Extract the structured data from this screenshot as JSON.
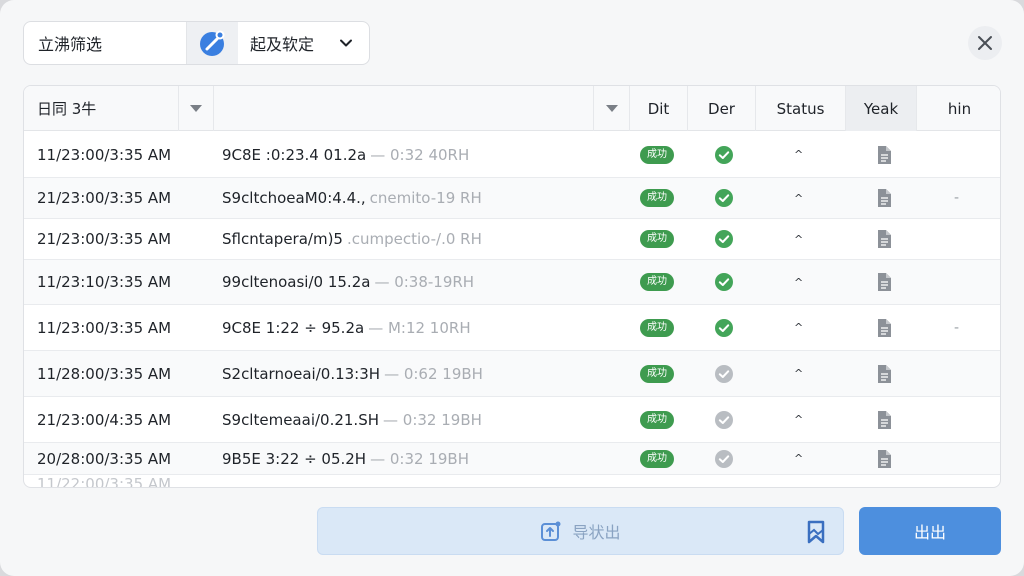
{
  "toolbar": {
    "filter_value": "立沸筛选",
    "filter_placeholder": "",
    "select_value": "起及软定"
  },
  "table": {
    "columns": [
      {
        "label": "日同 3牛"
      },
      {
        "label": ""
      },
      {
        "label": "Dit"
      },
      {
        "label": "Der"
      },
      {
        "label": "Status"
      },
      {
        "label": "Yeak"
      },
      {
        "label": "hin"
      }
    ],
    "rows": [
      {
        "date": "11/23:00/3:35 AM",
        "desc": "9C8E :0:23.4 01.2a",
        "desc_fade": "— 0:32 40RH",
        "badge": "成功",
        "check": "green",
        "caret": "^",
        "dash": ""
      },
      {
        "date": "21/23:00/3:35 AM",
        "desc": "S9cltchoeaM0:4.4.,",
        "desc_fade": "cnemito-19 RH",
        "badge": "成功",
        "check": "green",
        "caret": "^",
        "dash": "-"
      },
      {
        "date": "21/23:00/3:35 AM",
        "desc": "Sflcntapera/m)5",
        "desc_fade": ".cumpectio-/.0 RH",
        "badge": "成功",
        "check": "green",
        "caret": "^",
        "dash": ""
      },
      {
        "date": "11/23:10/3:35 AM",
        "desc": "99cltenoasi/0 15.2a",
        "desc_fade": "— 0:38-19RH",
        "badge": "成功",
        "check": "green",
        "caret": "^",
        "dash": ""
      },
      {
        "date": "11/23:00/3:35 AM",
        "desc": "9C8E 1:22 ÷ 95.2a",
        "desc_fade": "— M:12 10RH",
        "badge": "成功",
        "check": "green",
        "caret": "^",
        "dash": "-"
      },
      {
        "date": "11/28:00/3:35 AM",
        "desc": "S2cltarnoeai/0.13:3H",
        "desc_fade": "— 0:62 19BH",
        "badge": "成功",
        "check": "grey",
        "caret": "^",
        "dash": ""
      },
      {
        "date": "21/23:00/4:35 AM",
        "desc": "S9cltemeaai/0.21.SH",
        "desc_fade": "— 0:32 19BH",
        "badge": "成功",
        "check": "grey",
        "caret": "^",
        "dash": ""
      },
      {
        "date": "20/28:00/3:35 AM",
        "desc": "9B5E 3:22 ÷ 05.2H",
        "desc_fade": "— 0:32 19BH",
        "badge": "成功",
        "check": "grey",
        "caret": "^",
        "dash": ""
      }
    ]
  },
  "footer": {
    "export_label": "导状出",
    "primary_label": "出出"
  },
  "colors": {
    "accent": "#4d8fde",
    "success": "#3e9b4f",
    "check_green": "#43a559",
    "check_grey": "#b9bdc2"
  }
}
